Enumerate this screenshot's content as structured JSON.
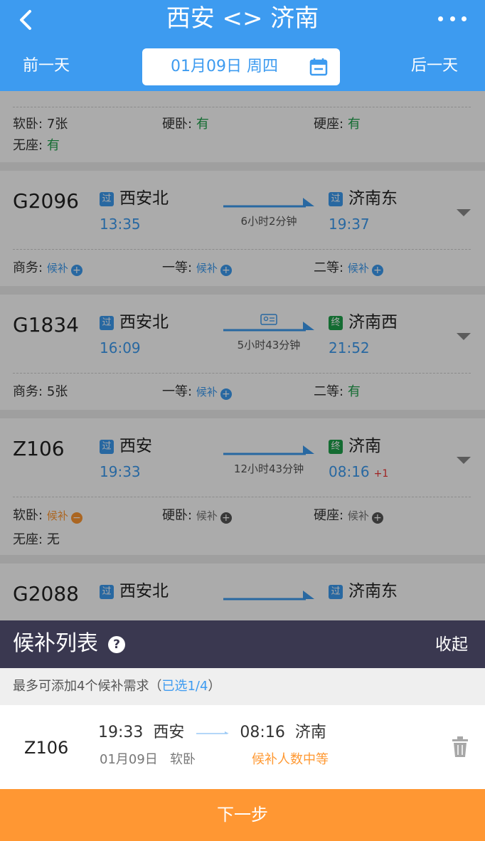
{
  "header": {
    "title": "西安 <> 济南"
  },
  "datebar": {
    "prev": "前一天",
    "date": "01月09日 周四",
    "next": "后一天"
  },
  "trains": [
    {
      "seats": [
        {
          "label": "软卧:",
          "value": "7张"
        },
        {
          "label": "硬卧:",
          "value": "有"
        },
        {
          "label": "硬座:",
          "value": "有"
        },
        {
          "label": "无座:",
          "value": "有"
        }
      ]
    },
    {
      "no": "G2096",
      "from": "西安北",
      "from_badge": "过",
      "dep": "13:35",
      "to": "济南东",
      "to_badge": "过",
      "arr": "19:37",
      "duration": "6小时2分钟",
      "seats": [
        {
          "label": "商务:",
          "value": "候补"
        },
        {
          "label": "一等:",
          "value": "候补"
        },
        {
          "label": "二等:",
          "value": "候补"
        }
      ]
    },
    {
      "no": "G1834",
      "from": "西安北",
      "from_badge": "过",
      "dep": "16:09",
      "to": "济南西",
      "to_badge": "终",
      "arr": "21:52",
      "duration": "5小时43分钟",
      "seats": [
        {
          "label": "商务:",
          "value": "5张"
        },
        {
          "label": "一等:",
          "value": "候补"
        },
        {
          "label": "二等:",
          "value": "有"
        }
      ]
    },
    {
      "no": "Z106",
      "from": "西安",
      "from_badge": "过",
      "dep": "19:33",
      "to": "济南",
      "to_badge": "终",
      "arr": "08:16",
      "plus_day": "+1",
      "duration": "12小时43分钟",
      "seats": [
        {
          "label": "软卧:",
          "value": "候补"
        },
        {
          "label": "硬卧:",
          "value": "候补"
        },
        {
          "label": "硬座:",
          "value": "候补"
        },
        {
          "label": "无座:",
          "value": "无"
        }
      ]
    },
    {
      "no": "G2088",
      "from": "西安北",
      "from_badge": "过",
      "to": "济南东",
      "to_badge": "过"
    }
  ],
  "panel": {
    "title": "候补列表",
    "help": "?",
    "collapse": "收起",
    "tip_prefix": "最多可添加4个候补需求（",
    "tip_selected": "已选1/4",
    "tip_suffix": "）",
    "item": {
      "no": "Z106",
      "dep": "19:33",
      "from": "西安",
      "arr": "08:16",
      "to": "济南",
      "date": "01月09日",
      "seat": "软卧",
      "status": "候补人数中等"
    }
  },
  "next_button": "下一步",
  "colors": {
    "primary": "#3d9bf0",
    "orange": "#ff9733",
    "green": "#1ea14b",
    "panel_dark": "#3a3850"
  }
}
